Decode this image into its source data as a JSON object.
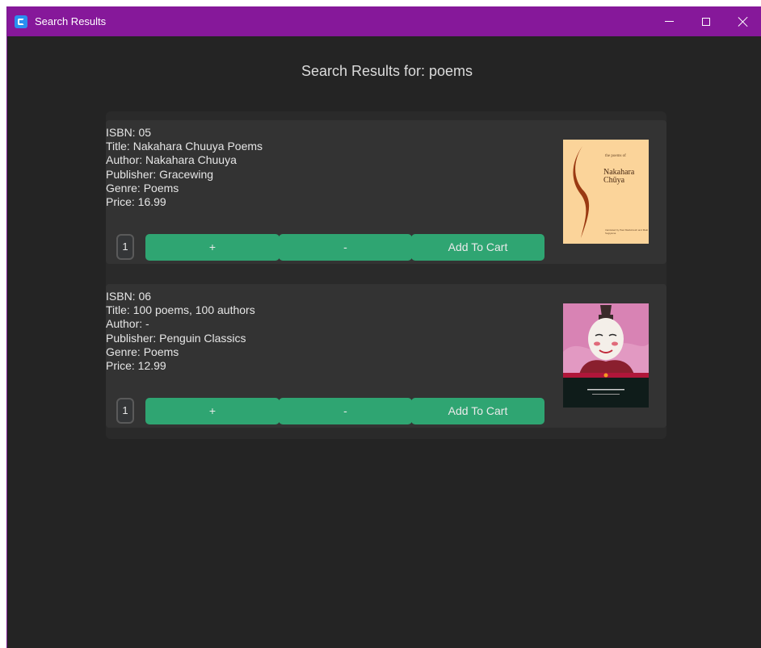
{
  "window": {
    "title": "Search Results",
    "colors": {
      "titlebar": "#86189a",
      "background": "#242424",
      "accent_button": "#2fa572"
    }
  },
  "heading": "Search Results for: poems",
  "results": [
    {
      "isbn": "ISBN: 05",
      "title": "Title: Nakahara Chuuya Poems",
      "author": "Author: Nakahara Chuuya",
      "publisher": "Publisher: Gracewing",
      "genre": "Genre: Poems",
      "price": "Price: 16.99",
      "quantity": "1",
      "plus_label": "+",
      "minus_label": "-",
      "add_label": "Add To Cart",
      "cover": {
        "small": "the poems of",
        "author": "Nakahara Chūya",
        "foot": "translated by Paul Mackintosh and Maki Sugiyama"
      }
    },
    {
      "isbn": "ISBN: 06",
      "title": "Title: 100 poems, 100 authors",
      "author": "Author: -",
      "publisher": "Publisher: Penguin Classics",
      "genre": "Genre: Poems",
      "price": "Price: 12.99",
      "quantity": "1",
      "plus_label": "+",
      "minus_label": "-",
      "add_label": "Add To Cart",
      "cover": {
        "band": "PENGUIN CLASSICS",
        "title": "One Hundred Poets, One Poem Each",
        "subtitle": "A Treasury of Classical Japanese Verse"
      }
    }
  ]
}
